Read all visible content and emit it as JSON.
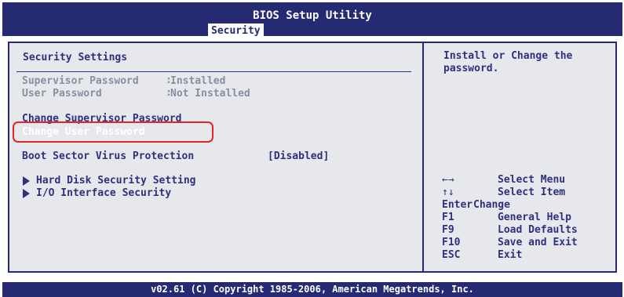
{
  "header": {
    "title": "BIOS Setup Utility",
    "active_tab": "Security"
  },
  "left_panel": {
    "section_title": "Security Settings",
    "status": [
      {
        "label": "Supervisor Password",
        "value": "Installed"
      },
      {
        "label": "User Password",
        "value": "Not Installed"
      }
    ],
    "change_supervisor": "Change Supervisor Password",
    "change_user": "Change User Password",
    "boot_sector": {
      "label": "Boot Sector Virus Protection",
      "value": "[Disabled]"
    },
    "submenus": [
      "Hard Disk Security Setting",
      "I/O Interface Security"
    ]
  },
  "help": {
    "text": "Install or Change the\npassword."
  },
  "keys": [
    {
      "key": "←→",
      "action": "Select Menu"
    },
    {
      "key": "↑↓",
      "action": "Select Item"
    },
    {
      "key": "Enter",
      "action": "Change"
    },
    {
      "key": "F1",
      "action": "General Help"
    },
    {
      "key": "F9",
      "action": "Load Defaults"
    },
    {
      "key": "F10",
      "action": "Save and Exit"
    },
    {
      "key": "ESC",
      "action": "Exit"
    }
  ],
  "footer": {
    "copyright": "v02.61 (C) Copyright 1985-2006, American Megatrends, Inc."
  },
  "colors": {
    "bios_blue": "#252a72",
    "panel_gray": "#e7e8eb",
    "highlight_red": "#e0262b"
  }
}
